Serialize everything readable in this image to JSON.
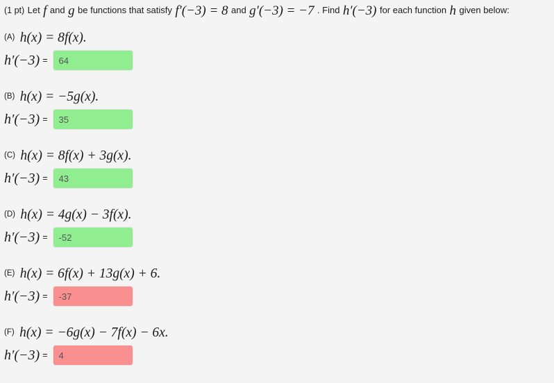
{
  "header": {
    "points": "(1 pt)",
    "text_1": "Let",
    "math_f": "f",
    "text_2": "and",
    "math_g": "g",
    "text_3": "be functions that satisfy",
    "given_1": "f′(−3) = 8",
    "text_4": "and",
    "given_2": "g′(−3) = −7",
    "text_5": ". Find",
    "target": "h′(−3)",
    "text_6": "for each function",
    "math_h": "h",
    "text_7": "given below:"
  },
  "answer_prompt": {
    "symbol": "h′(−3)",
    "equals": "="
  },
  "colors": {
    "correct": "#90ee90",
    "incorrect": "#fa8f8f",
    "page_background": "#f4f4f4",
    "answer_text": "#555555"
  },
  "parts": [
    {
      "label": "(A)",
      "expression": "h(x) = 8f(x).",
      "answer_value": "64",
      "status": "correct"
    },
    {
      "label": "(B)",
      "expression": "h(x) = −5g(x).",
      "answer_value": "35",
      "status": "correct"
    },
    {
      "label": "(C)",
      "expression": "h(x) = 8f(x) + 3g(x).",
      "answer_value": "43",
      "status": "correct"
    },
    {
      "label": "(D)",
      "expression": "h(x) = 4g(x) − 3f(x).",
      "answer_value": "-52",
      "status": "correct"
    },
    {
      "label": "(E)",
      "expression": "h(x) = 6f(x) + 13g(x) + 6.",
      "answer_value": "-37",
      "status": "incorrect"
    },
    {
      "label": "(F)",
      "expression": "h(x) = −6g(x) − 7f(x) − 6x.",
      "answer_value": "4",
      "status": "incorrect"
    }
  ]
}
